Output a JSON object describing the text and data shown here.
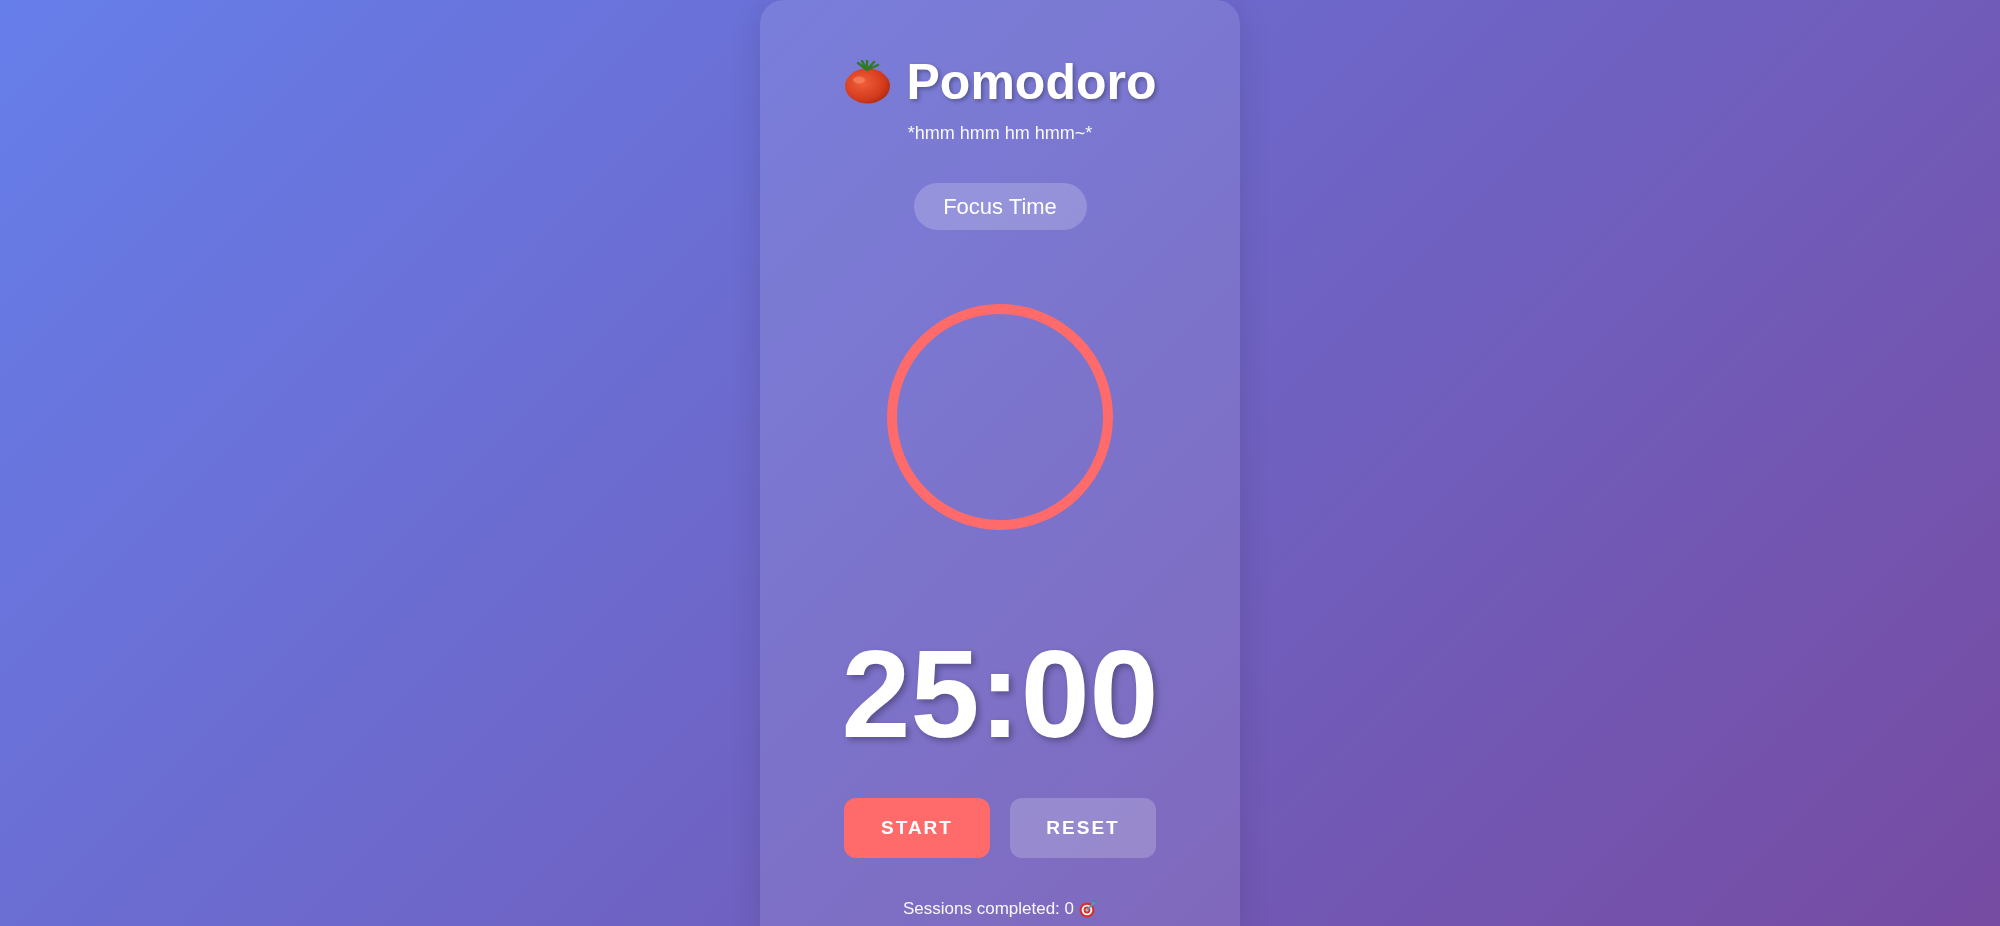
{
  "header": {
    "title": "Pomodoro",
    "subtitle": "*hmm hmm hm hmm~*"
  },
  "mode": {
    "label": "Focus Time"
  },
  "timer": {
    "ring": {
      "level": 1
    },
    "time": "25:00"
  },
  "buttons": [
    {
      "label": "START",
      "kind": "primary"
    },
    {
      "label": "RESET",
      "kind": "secondary"
    }
  ],
  "sessions": {
    "label": "Sessions completed: 0"
  }
}
